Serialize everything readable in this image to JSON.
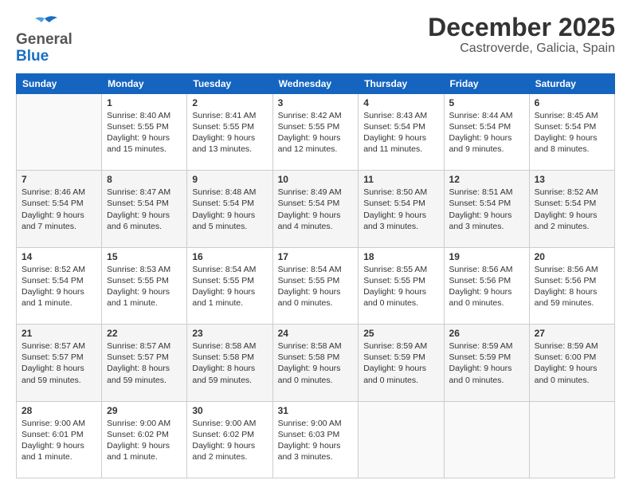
{
  "header": {
    "logo_general": "General",
    "logo_blue": "Blue",
    "month_title": "December 2025",
    "location": "Castroverde, Galicia, Spain"
  },
  "columns": [
    "Sunday",
    "Monday",
    "Tuesday",
    "Wednesday",
    "Thursday",
    "Friday",
    "Saturday"
  ],
  "weeks": [
    [
      {
        "day": "",
        "info": ""
      },
      {
        "day": "1",
        "info": "Sunrise: 8:40 AM\nSunset: 5:55 PM\nDaylight: 9 hours\nand 15 minutes."
      },
      {
        "day": "2",
        "info": "Sunrise: 8:41 AM\nSunset: 5:55 PM\nDaylight: 9 hours\nand 13 minutes."
      },
      {
        "day": "3",
        "info": "Sunrise: 8:42 AM\nSunset: 5:55 PM\nDaylight: 9 hours\nand 12 minutes."
      },
      {
        "day": "4",
        "info": "Sunrise: 8:43 AM\nSunset: 5:54 PM\nDaylight: 9 hours\nand 11 minutes."
      },
      {
        "day": "5",
        "info": "Sunrise: 8:44 AM\nSunset: 5:54 PM\nDaylight: 9 hours\nand 9 minutes."
      },
      {
        "day": "6",
        "info": "Sunrise: 8:45 AM\nSunset: 5:54 PM\nDaylight: 9 hours\nand 8 minutes."
      }
    ],
    [
      {
        "day": "7",
        "info": "Sunrise: 8:46 AM\nSunset: 5:54 PM\nDaylight: 9 hours\nand 7 minutes."
      },
      {
        "day": "8",
        "info": "Sunrise: 8:47 AM\nSunset: 5:54 PM\nDaylight: 9 hours\nand 6 minutes."
      },
      {
        "day": "9",
        "info": "Sunrise: 8:48 AM\nSunset: 5:54 PM\nDaylight: 9 hours\nand 5 minutes."
      },
      {
        "day": "10",
        "info": "Sunrise: 8:49 AM\nSunset: 5:54 PM\nDaylight: 9 hours\nand 4 minutes."
      },
      {
        "day": "11",
        "info": "Sunrise: 8:50 AM\nSunset: 5:54 PM\nDaylight: 9 hours\nand 3 minutes."
      },
      {
        "day": "12",
        "info": "Sunrise: 8:51 AM\nSunset: 5:54 PM\nDaylight: 9 hours\nand 3 minutes."
      },
      {
        "day": "13",
        "info": "Sunrise: 8:52 AM\nSunset: 5:54 PM\nDaylight: 9 hours\nand 2 minutes."
      }
    ],
    [
      {
        "day": "14",
        "info": "Sunrise: 8:52 AM\nSunset: 5:54 PM\nDaylight: 9 hours\nand 1 minute."
      },
      {
        "day": "15",
        "info": "Sunrise: 8:53 AM\nSunset: 5:55 PM\nDaylight: 9 hours\nand 1 minute."
      },
      {
        "day": "16",
        "info": "Sunrise: 8:54 AM\nSunset: 5:55 PM\nDaylight: 9 hours\nand 1 minute."
      },
      {
        "day": "17",
        "info": "Sunrise: 8:54 AM\nSunset: 5:55 PM\nDaylight: 9 hours\nand 0 minutes."
      },
      {
        "day": "18",
        "info": "Sunrise: 8:55 AM\nSunset: 5:55 PM\nDaylight: 9 hours\nand 0 minutes."
      },
      {
        "day": "19",
        "info": "Sunrise: 8:56 AM\nSunset: 5:56 PM\nDaylight: 9 hours\nand 0 minutes."
      },
      {
        "day": "20",
        "info": "Sunrise: 8:56 AM\nSunset: 5:56 PM\nDaylight: 8 hours\nand 59 minutes."
      }
    ],
    [
      {
        "day": "21",
        "info": "Sunrise: 8:57 AM\nSunset: 5:57 PM\nDaylight: 8 hours\nand 59 minutes."
      },
      {
        "day": "22",
        "info": "Sunrise: 8:57 AM\nSunset: 5:57 PM\nDaylight: 8 hours\nand 59 minutes."
      },
      {
        "day": "23",
        "info": "Sunrise: 8:58 AM\nSunset: 5:58 PM\nDaylight: 8 hours\nand 59 minutes."
      },
      {
        "day": "24",
        "info": "Sunrise: 8:58 AM\nSunset: 5:58 PM\nDaylight: 9 hours\nand 0 minutes."
      },
      {
        "day": "25",
        "info": "Sunrise: 8:59 AM\nSunset: 5:59 PM\nDaylight: 9 hours\nand 0 minutes."
      },
      {
        "day": "26",
        "info": "Sunrise: 8:59 AM\nSunset: 5:59 PM\nDaylight: 9 hours\nand 0 minutes."
      },
      {
        "day": "27",
        "info": "Sunrise: 8:59 AM\nSunset: 6:00 PM\nDaylight: 9 hours\nand 0 minutes."
      }
    ],
    [
      {
        "day": "28",
        "info": "Sunrise: 9:00 AM\nSunset: 6:01 PM\nDaylight: 9 hours\nand 1 minute."
      },
      {
        "day": "29",
        "info": "Sunrise: 9:00 AM\nSunset: 6:02 PM\nDaylight: 9 hours\nand 1 minute."
      },
      {
        "day": "30",
        "info": "Sunrise: 9:00 AM\nSunset: 6:02 PM\nDaylight: 9 hours\nand 2 minutes."
      },
      {
        "day": "31",
        "info": "Sunrise: 9:00 AM\nSunset: 6:03 PM\nDaylight: 9 hours\nand 3 minutes."
      },
      {
        "day": "",
        "info": ""
      },
      {
        "day": "",
        "info": ""
      },
      {
        "day": "",
        "info": ""
      }
    ]
  ]
}
